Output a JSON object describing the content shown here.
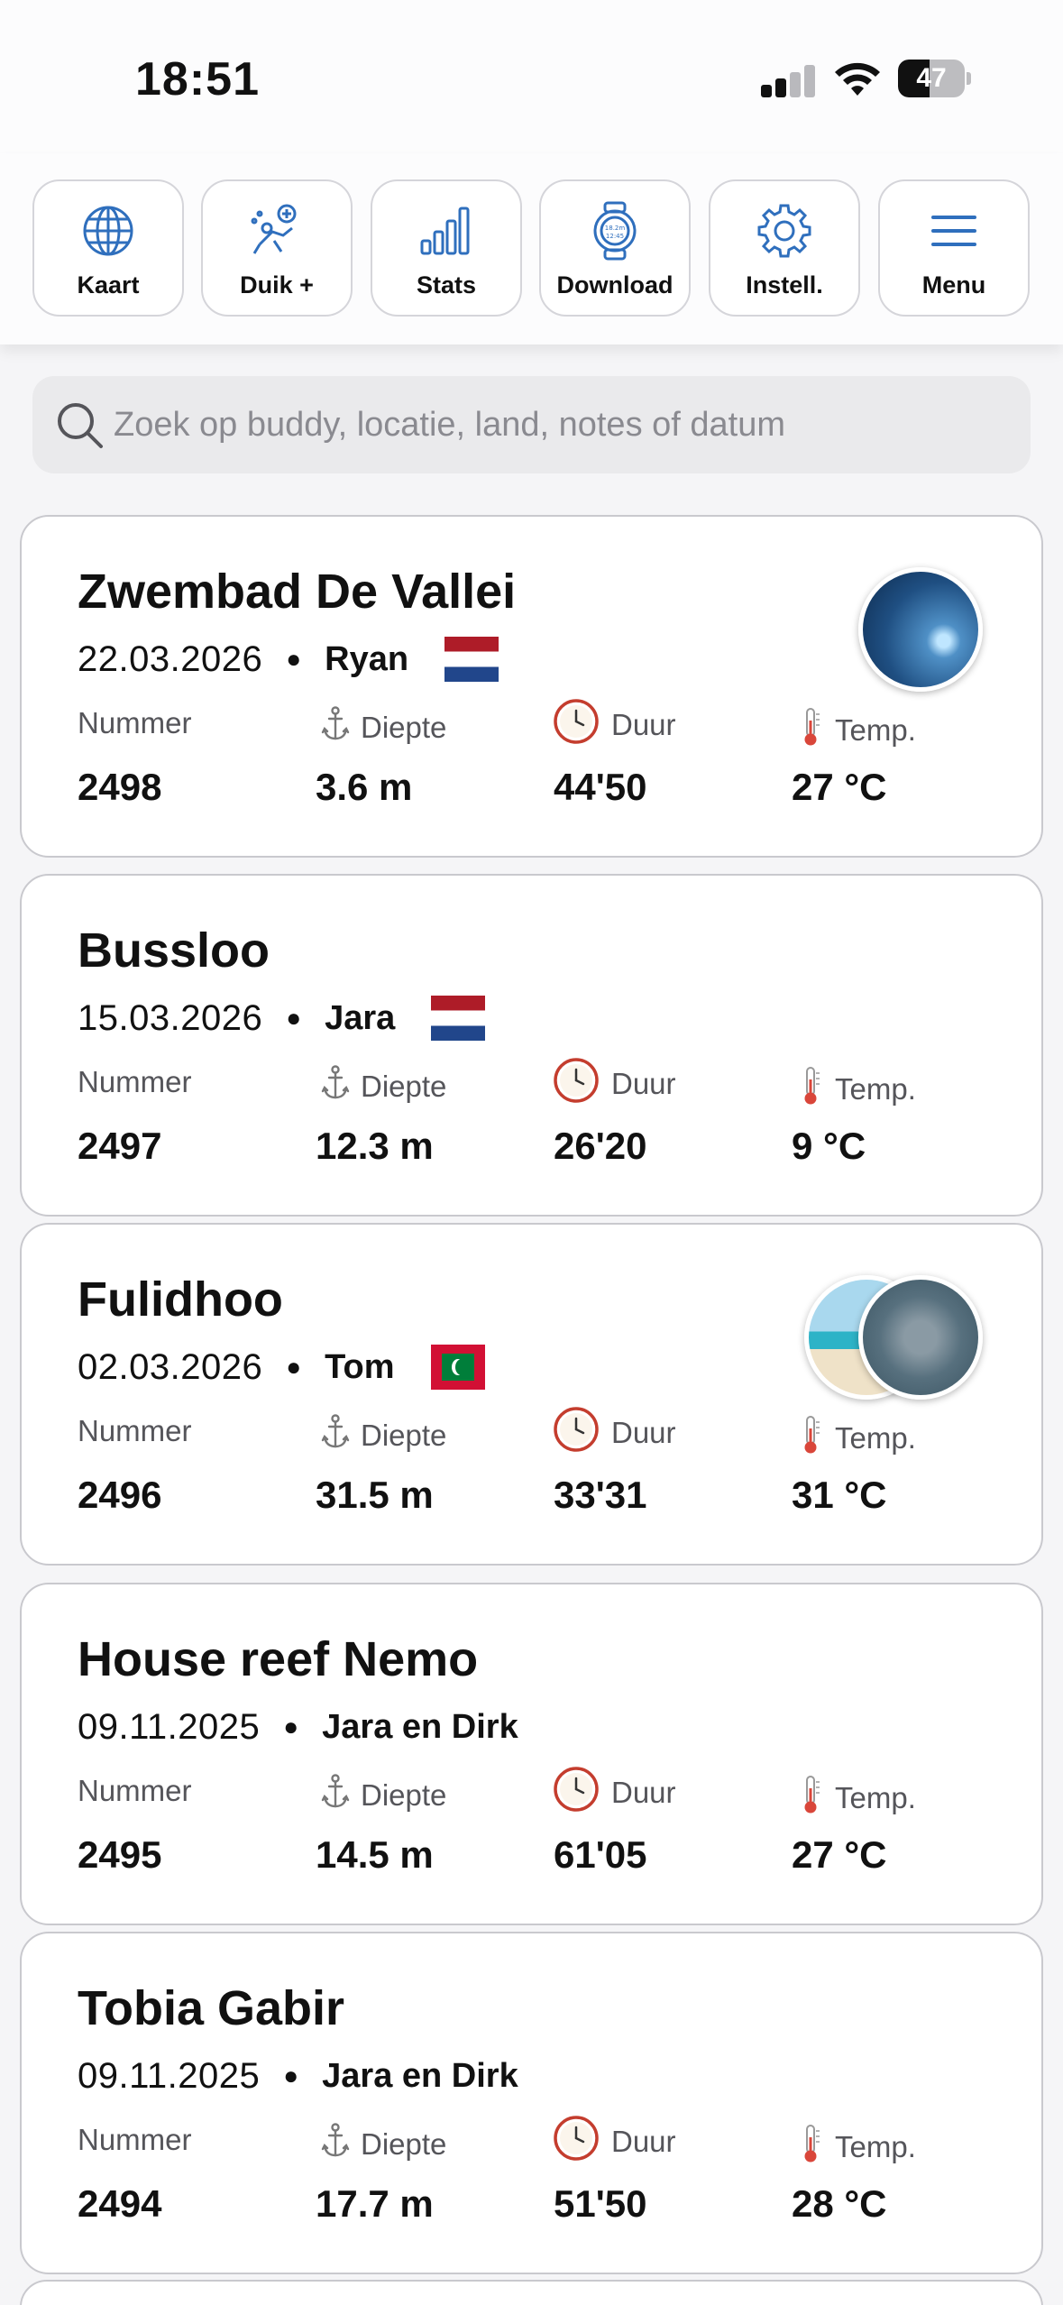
{
  "status_bar": {
    "time": "18:51",
    "battery": "47",
    "battery_level": 0.47
  },
  "toolbar": {
    "buttons": [
      {
        "label": "Kaart",
        "icon": "globe-icon"
      },
      {
        "label": "Duik +",
        "icon": "diver-add-icon"
      },
      {
        "label": "Stats",
        "icon": "bar-chart-icon"
      },
      {
        "label": "Download",
        "icon": "dive-computer-icon"
      },
      {
        "label": "Instell.",
        "icon": "gear-icon"
      },
      {
        "label": "Menu",
        "icon": "hamburger-icon"
      }
    ],
    "accent_color": "#2f6fbd"
  },
  "search": {
    "placeholder": "Zoek op buddy, locatie, land, notes of datum",
    "value": ""
  },
  "labels": {
    "number": "Nummer",
    "depth": "Diepte",
    "duration": "Duur",
    "temp": "Temp."
  },
  "dives": [
    {
      "title": "Zwembad De Vallei",
      "date": "22.03.2026",
      "buddy": "Ryan",
      "flag": "netherlands-flag",
      "number": "2498",
      "depth": "3.6 m",
      "duration": "44'50",
      "temp": "27 °C",
      "photos": [
        "pool-photo"
      ]
    },
    {
      "title": "Bussloo",
      "date": "15.03.2026",
      "buddy": "Jara",
      "flag": "netherlands-flag",
      "number": "2497",
      "depth": "12.3 m",
      "duration": "26'20",
      "temp": "9 °C",
      "photos": []
    },
    {
      "title": "Fulidhoo",
      "date": "02.03.2026",
      "buddy": "Tom",
      "flag": "maldives-flag",
      "number": "2496",
      "depth": "31.5 m",
      "duration": "33'31",
      "temp": "31 °C",
      "photos": [
        "beach-photo",
        "shark-photo"
      ]
    },
    {
      "title": "House reef Nemo",
      "date": "09.11.2025",
      "buddy": "Jara en Dirk",
      "flag": "",
      "number": "2495",
      "depth": "14.5 m",
      "duration": "61'05",
      "temp": "27 °C",
      "photos": []
    },
    {
      "title": "Tobia Gabir",
      "date": "09.11.2025",
      "buddy": "Jara en Dirk",
      "flag": "",
      "number": "2494",
      "depth": "17.7 m",
      "duration": "51'50",
      "temp": "28 °C",
      "photos": []
    }
  ]
}
